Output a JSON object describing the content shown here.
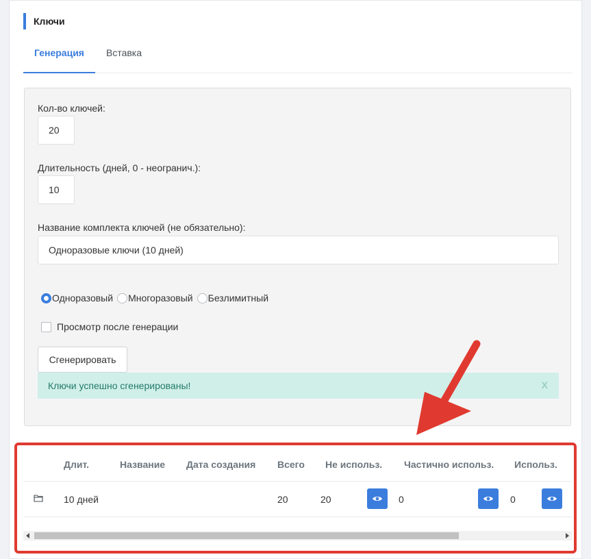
{
  "section": {
    "title": "Ключи"
  },
  "tabs": [
    {
      "label": "Генерация",
      "active": true
    },
    {
      "label": "Вставка",
      "active": false
    }
  ],
  "form": {
    "count_label": "Кол-во ключей:",
    "count_value": "20",
    "duration_label": "Длительность (дней, 0 - неогранич.):",
    "duration_value": "10",
    "name_label": "Название комплекта ключей (не обязательно):",
    "name_value": "Одноразовые ключи (10 дней)",
    "radio_options": [
      {
        "label": "Одноразовый",
        "checked": true
      },
      {
        "label": "Многоразовый",
        "checked": false
      },
      {
        "label": "Безлимитный",
        "checked": false
      }
    ],
    "view_after_label": "Просмотр после генерации",
    "view_after_checked": false,
    "generate_button": "Сгенерировать"
  },
  "alert": {
    "message": "Ключи успешно сгенерированы!",
    "close": "X",
    "color": "#d0efe9"
  },
  "table": {
    "headers": [
      "Длит.",
      "Название",
      "Дата создания",
      "Всего",
      "Не использ.",
      "Частично использ.",
      "Использ."
    ],
    "rows": [
      {
        "icon": "folder-icon",
        "duration": "10 дней",
        "name": "",
        "created": "",
        "total": "20",
        "unused": "20",
        "partial": "0",
        "used": "0"
      }
    ]
  },
  "colors": {
    "accent": "#3b7ddd",
    "highlight": "#e03a30"
  }
}
